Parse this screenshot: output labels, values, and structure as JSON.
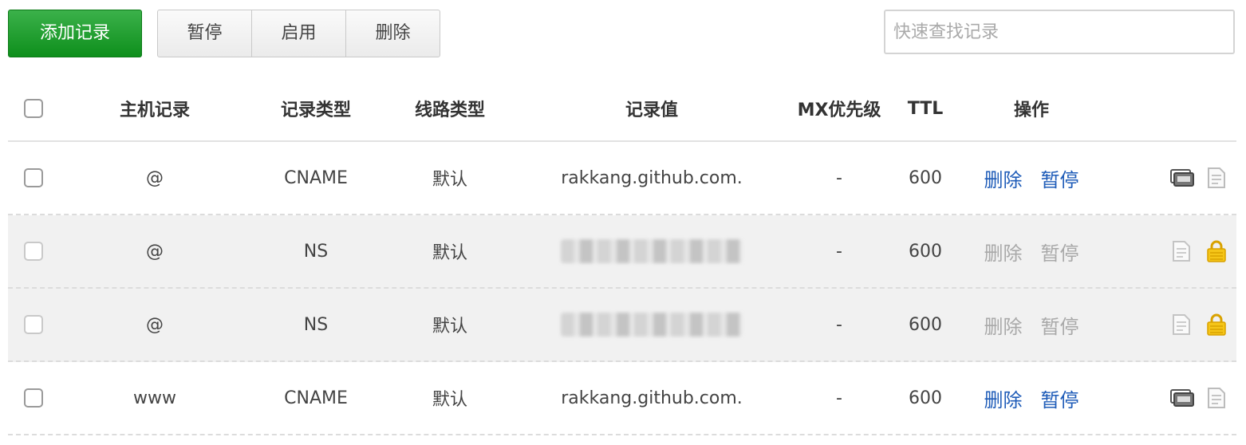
{
  "toolbar": {
    "add_label": "添加记录",
    "pause_label": "暂停",
    "enable_label": "启用",
    "delete_label": "删除"
  },
  "search": {
    "placeholder": "快速查找记录",
    "value": ""
  },
  "table": {
    "headers": {
      "host": "主机记录",
      "type": "记录类型",
      "line": "线路类型",
      "value": "记录值",
      "mx": "MX优先级",
      "ttl": "TTL",
      "ops": "操作"
    },
    "rows": [
      {
        "host": "@",
        "type": "CNAME",
        "line": "默认",
        "value": "rakkang.github.com.",
        "mx": "-",
        "ttl": "600",
        "delete": "删除",
        "pause": "暂停",
        "state": "active"
      },
      {
        "host": "@",
        "type": "NS",
        "line": "默认",
        "value": "",
        "mx": "-",
        "ttl": "600",
        "delete": "删除",
        "pause": "暂停",
        "state": "locked"
      },
      {
        "host": "@",
        "type": "NS",
        "line": "默认",
        "value": "",
        "mx": "-",
        "ttl": "600",
        "delete": "删除",
        "pause": "暂停",
        "state": "locked"
      },
      {
        "host": "www",
        "type": "CNAME",
        "line": "默认",
        "value": "rakkang.github.com.",
        "mx": "-",
        "ttl": "600",
        "delete": "删除",
        "pause": "暂停",
        "state": "active"
      }
    ]
  },
  "colors": {
    "primary_green": "#1a9a28",
    "link_blue": "#1f5cb8",
    "disabled_gray": "#a9a9a9",
    "lock_yellow": "#f0b400"
  },
  "icons": {
    "remark": "remark-icon",
    "note": "note-icon",
    "lock": "lock-icon"
  }
}
